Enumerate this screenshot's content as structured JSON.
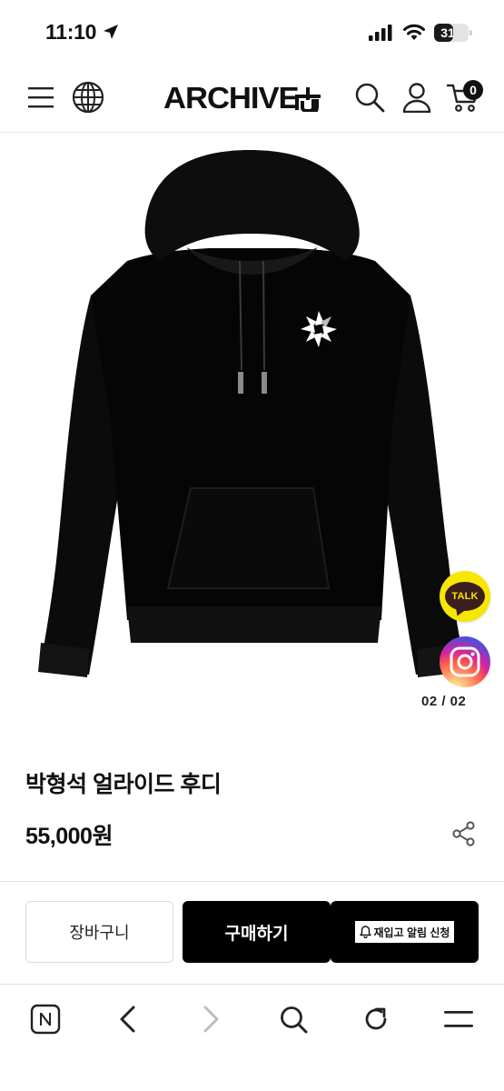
{
  "status_bar": {
    "time": "11:10",
    "battery_level": "31",
    "battery_fraction": 0.31
  },
  "header": {
    "logo": "ARCHIVE",
    "cart_count": "0",
    "icons": [
      "menu-icon",
      "globe-icon",
      "search-icon",
      "user-icon",
      "cart-icon"
    ]
  },
  "product": {
    "image_counter": "02 / 02",
    "title": "박형석 얼라이드 후디",
    "price": "55,000원",
    "color": "#000000"
  },
  "floating": {
    "kakao_label": "TALK",
    "kakao_color": "#f7e600"
  },
  "actions": {
    "cart_label": "장바구니",
    "buy_label": "구매하기",
    "restock_label": "재입고 알림 신청"
  },
  "browser_toolbar": {
    "icons": [
      "naver-icon",
      "back-icon",
      "forward-icon",
      "search-icon",
      "refresh-icon",
      "menu-icon"
    ]
  }
}
